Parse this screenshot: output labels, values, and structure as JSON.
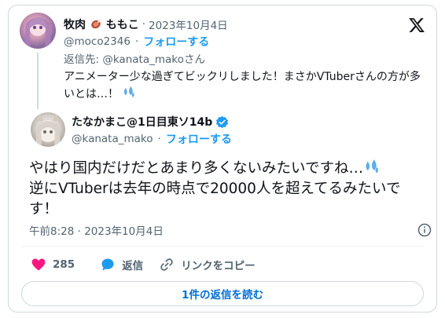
{
  "parent_tweet": {
    "display_name_a": "牧肉",
    "display_name_b": "ももこ",
    "separator": "·",
    "date": "2023年10月4日",
    "handle": "@moco2346",
    "dot": "·",
    "follow_label": "フォローする",
    "reply_to": "返信先: @kanata_makoさん",
    "text": "アニメーター少な過ぎてビックリしました！まさかVTuberさんの方が多いとは…！"
  },
  "main_tweet": {
    "display_name": "たなかまこ@1日目東ソ14b",
    "handle": "@kanata_mako",
    "dot": "·",
    "follow_label": "フォローする",
    "text_line1": "やはり国内だけだとあまり多くないみたいですね…",
    "text_rest": "逆にVTuberは去年の時点で20000人を超えてるみたいです！",
    "timestamp": "午前8:28 · 2023年10月4日"
  },
  "actions": {
    "like_count": "285",
    "reply_label": "返信",
    "copy_link_label": "リンクをコピー"
  },
  "read_replies_label": "1件の返信を読む",
  "icons": [
    "x-logo-icon",
    "meat-icon",
    "verified-badge-icon",
    "sweat-drops-icon",
    "info-icon",
    "heart-icon",
    "reply-bubble-icon",
    "link-icon"
  ],
  "colors": {
    "accent": "#1d9bf0",
    "like": "#f91880",
    "muted": "#536471",
    "text": "#0f1419",
    "verified": "#1d9bf0"
  }
}
